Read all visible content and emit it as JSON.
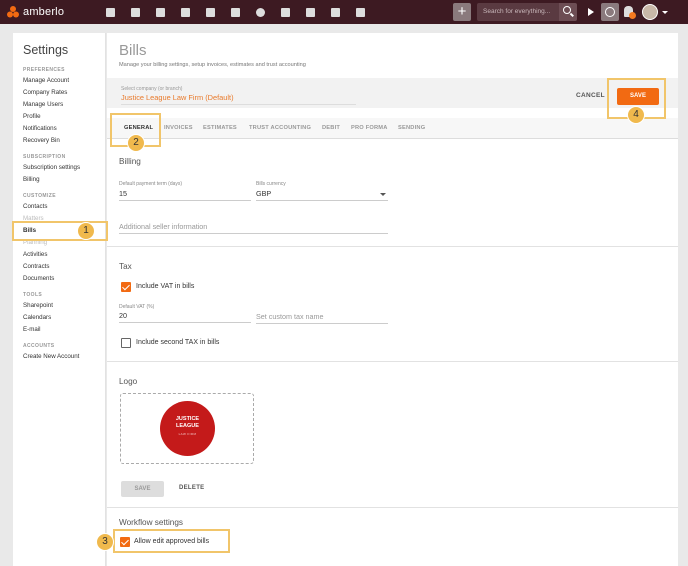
{
  "topbar": {
    "brand": "amberlo",
    "search_placeholder": "Search for everything...",
    "icons": [
      "dashboard-icon",
      "contacts-icon",
      "matters-icon",
      "documents-icon",
      "bank-icon",
      "calendar-icon",
      "whatsapp-icon",
      "folder-icon",
      "file-icon",
      "mail-icon",
      "reports-icon"
    ]
  },
  "sidebar": {
    "title": "Settings",
    "sections": [
      {
        "label": "PREFERENCES",
        "items": [
          "Manage Account",
          "Company Rates",
          "Manage Users",
          "Profile",
          "Notifications",
          "Recovery Bin"
        ]
      },
      {
        "label": "SUBSCRIPTION",
        "items": [
          "Subscription settings",
          "Billing"
        ]
      },
      {
        "label": "CUSTOMIZE",
        "items": [
          "Contacts",
          "Matters",
          "Bills",
          "Planning",
          "Activities",
          "Contracts",
          "Documents"
        ]
      },
      {
        "label": "TOOLS",
        "items": [
          "Sharepoint",
          "Calendars",
          "E-mail"
        ]
      },
      {
        "label": "ACCOUNTS",
        "items": [
          "Create New Account"
        ]
      }
    ],
    "active_item": "Bills"
  },
  "main": {
    "title": "Bills",
    "subtitle": "Manage your billing settings, setup invoices, estimates and trust accounting",
    "company_label": "Select company (or branch)",
    "company_value": "Justice League Law Firm (Default)",
    "cancel_label": "CANCEL",
    "save_label": "SAVE",
    "tabs": [
      "GENERAL",
      "INVOICES",
      "ESTIMATES",
      "TRUST ACCOUNTING",
      "DEBIT",
      "PRO FORMA",
      "SENDING"
    ],
    "active_tab": "GENERAL",
    "billing": {
      "title": "Billing",
      "payment_term_label": "Default payment term (days)",
      "payment_term_value": "15",
      "currency_label": "Bills currency",
      "currency_value": "GBP",
      "seller_info_placeholder": "Additional seller information"
    },
    "tax": {
      "title": "Tax",
      "include_vat_label": "Include VAT in bills",
      "include_vat_checked": true,
      "default_vat_label": "Default VAT (%)",
      "default_vat_value": "20",
      "custom_tax_placeholder": "Set custom tax name",
      "second_tax_label": "Include second TAX in bills",
      "second_tax_checked": false
    },
    "logo": {
      "title": "Logo",
      "logo_line1": "JUSTICE",
      "logo_line2": "LEAGUE",
      "logo_line3": "LAW FIRM",
      "save_label": "SAVE",
      "delete_label": "DELETE"
    },
    "workflow": {
      "title": "Workflow settings",
      "allow_edit_label": "Allow edit approved bills",
      "allow_edit_checked": true
    }
  },
  "annotations": [
    "1",
    "2",
    "3",
    "4"
  ],
  "colors": {
    "topbar": "#3d1a22",
    "accent": "#f26a12",
    "highlight": "#f1c56a",
    "logo_red": "#c41a1a"
  }
}
